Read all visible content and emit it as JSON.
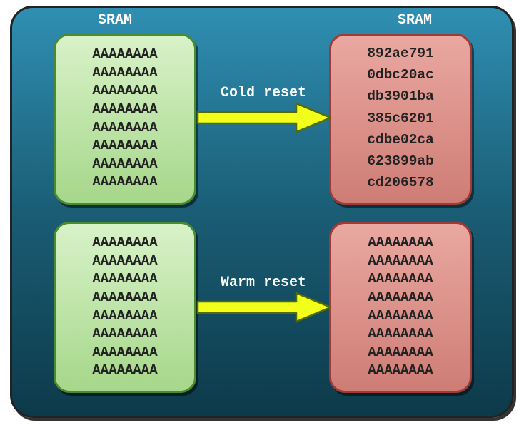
{
  "labels": {
    "sram_left": "SRAM",
    "sram_right": "SRAM",
    "cold_reset": "Cold reset",
    "warm_reset": "Warm reset"
  },
  "topLeft": [
    "AAAAAAAA",
    "AAAAAAAA",
    "AAAAAAAA",
    "AAAAAAAA",
    "AAAAAAAA",
    "AAAAAAAA",
    "AAAAAAAA",
    "AAAAAAAA"
  ],
  "topRight": [
    "892ae791",
    "0dbc20ac",
    "db3901ba",
    "385c6201",
    "cdbe02ca",
    "623899ab",
    "cd206578"
  ],
  "bottomLeft": [
    "AAAAAAAA",
    "AAAAAAAA",
    "AAAAAAAA",
    "AAAAAAAA",
    "AAAAAAAA",
    "AAAAAAAA",
    "AAAAAAAA",
    "AAAAAAAA"
  ],
  "bottomRight": [
    "AAAAAAAA",
    "AAAAAAAA",
    "AAAAAAAA",
    "AAAAAAAA",
    "AAAAAAAA",
    "AAAAAAAA",
    "AAAAAAAA",
    "AAAAAAAA"
  ],
  "colors": {
    "arrow": "#f2ff1a",
    "arrowStroke": "#556b00"
  }
}
